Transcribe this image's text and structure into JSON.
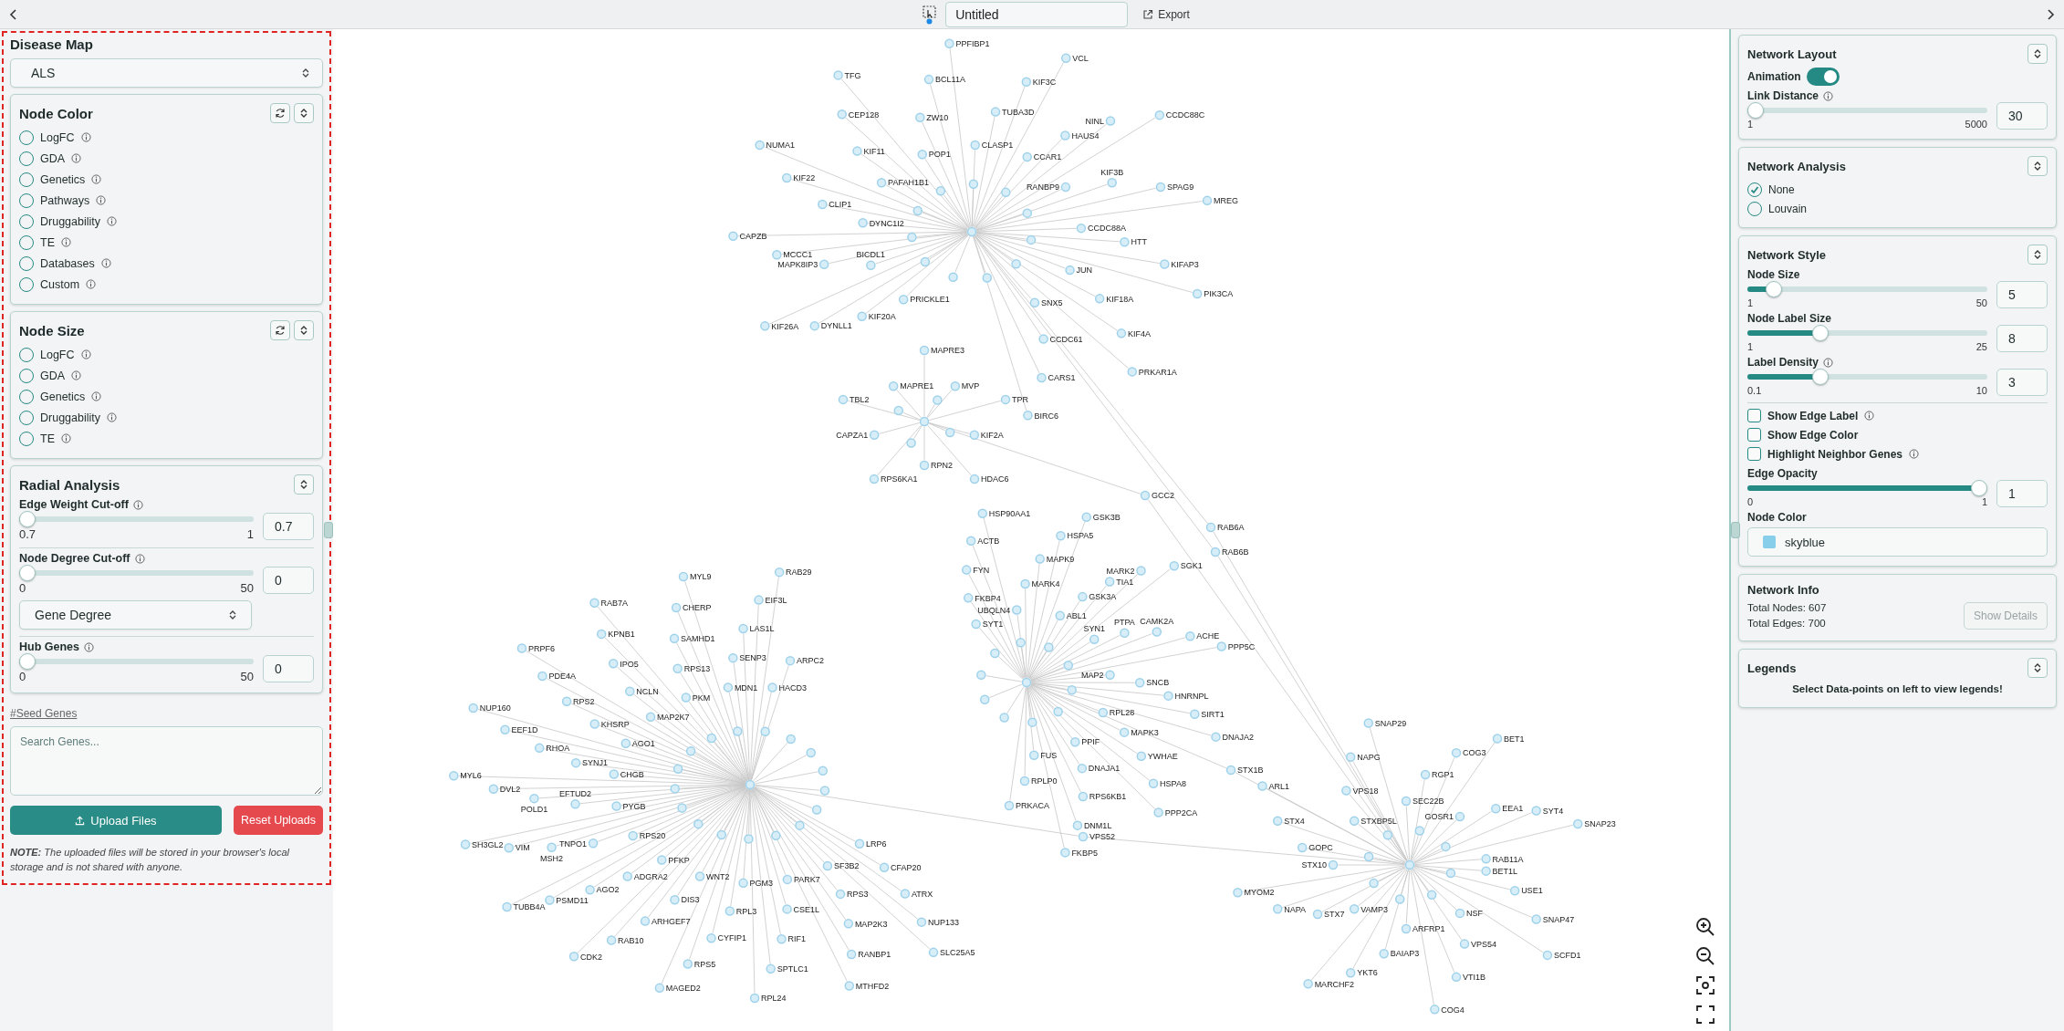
{
  "top_bar": {
    "document_title": "Untitled",
    "export": "Export"
  },
  "left_panel": {
    "disease_map": {
      "title": "Disease Map",
      "value": "ALS"
    },
    "cards": [
      {
        "kind": "radios",
        "title": "Node Color",
        "refresh": true,
        "options": [
          {
            "label": "LogFC",
            "info": true,
            "selected": false
          },
          {
            "label": "GDA",
            "info": true,
            "selected": false
          },
          {
            "label": "Genetics",
            "info": true,
            "selected": false
          },
          {
            "label": "Pathways",
            "info": true,
            "selected": false
          },
          {
            "label": "Druggability",
            "info": true,
            "selected": false
          },
          {
            "label": "TE",
            "info": true,
            "selected": false
          },
          {
            "label": "Databases",
            "info": true,
            "selected": false
          },
          {
            "label": "Custom",
            "info": true,
            "selected": false
          }
        ]
      },
      {
        "kind": "radios",
        "title": "Node Size",
        "refresh": true,
        "options": [
          {
            "label": "LogFC",
            "info": true,
            "selected": false
          },
          {
            "label": "GDA",
            "info": true,
            "selected": false
          },
          {
            "label": "Genetics",
            "info": true,
            "selected": false
          },
          {
            "label": "Druggability",
            "info": true,
            "selected": false
          },
          {
            "label": "TE",
            "info": true,
            "selected": false
          }
        ]
      },
      {
        "kind": "controls",
        "title": "Radial Analysis",
        "items": [
          {
            "kind": "slider",
            "label": "Edge Weight Cut-off",
            "info": true,
            "min": "0.7",
            "max": "1",
            "value": "0.7",
            "level": 0
          },
          {
            "kind": "slider",
            "label": "Node Degree Cut-off",
            "info": true,
            "min": "0",
            "max": "50",
            "value": "0",
            "level": 0,
            "rule_above": true
          },
          {
            "kind": "select",
            "value": "Gene Degree"
          },
          {
            "kind": "slider",
            "label": "Hub Genes",
            "info": true,
            "min": "0",
            "max": "50",
            "value": "0",
            "level": 0,
            "rule_above": true
          }
        ]
      }
    ],
    "seed_link": "#Seed Genes",
    "search_placeholder": "Search Genes...",
    "upload": "Upload Files",
    "reset": "Reset Uploads",
    "note": "**NOTE:** The uploaded files will be stored in your browser's local storage and is not shared with anyone."
  },
  "graph": {
    "hubs": [
      {
        "labels": [
          "PPFIBP1",
          "VCL",
          "TFG",
          "BCL11A",
          "KIF3C",
          "CEP128",
          "ZW10",
          "TUBA3D",
          "NINL",
          "CCDC88C",
          "HAUS4",
          "NUMA1",
          "KIF11",
          "CLASP1",
          "POP1",
          "CCAR1",
          "KIF22",
          "KIF3B",
          "PAFAH1B1",
          "RANBP9",
          "SPAG9",
          "CLIP1",
          "MREG",
          "DYNC1I2",
          "CCDC88A",
          "CAPZB",
          "HTT",
          "MCCC1",
          "BICDL1",
          "MAPK8IP3",
          "JUN",
          "KIFAP3",
          "PRICKLE1",
          "SNX5",
          "KIF18A",
          "PIK3CA",
          "KIF20A",
          "KIF26A",
          "DYNLL1",
          "CCDC61",
          "KIF4A",
          "CARS1",
          "PRKAR1A",
          "BIRC6"
        ]
      },
      {
        "labels": [
          "MAPRE3",
          "MAPRE1",
          "MVP",
          "TBL2",
          "TPR",
          "CAPZA1",
          "KIF2A",
          "RPN2",
          "RPS6KA1",
          "HDAC6"
        ]
      },
      {
        "labels": [
          "HSP90AA1",
          "GSK3B",
          "ACTB",
          "HSPA5",
          "MAPK9",
          "FYN",
          "MARK2",
          "SGK1",
          "MARK4",
          "TIA1",
          "FKBP4",
          "GSK3A",
          "UBQLN4",
          "ABL1",
          "SYT1",
          "PTPA",
          "CAMK2A",
          "SYN1",
          "ACHE",
          "PPP5C",
          "MAP2",
          "SNCB",
          "HNRNPL",
          "RPL28",
          "SIRT1",
          "MAPK3",
          "PPIF",
          "DNAJA2",
          "FUS",
          "YWHAE",
          "DNAJA1",
          "RPLP0",
          "HSPA8",
          "RPS6KB1",
          "PRKACA",
          "PPP2CA",
          "DNM1L",
          "FKBP5"
        ]
      },
      {
        "labels": [
          "MYL9",
          "RAB29",
          "RAB7A",
          "EIF3L",
          "CHERP",
          "KPNB1",
          "LAS1L",
          "SAMHD1",
          "PRPF6",
          "IPO5",
          "SENP3",
          "ARPC2",
          "RPS13",
          "PDE4A",
          "NCLN",
          "MDN1",
          "HACD3",
          "NUP160",
          "RPS2",
          "PKM",
          "EEF1D",
          "KHSRP",
          "MAP2K7",
          "RHOA",
          "AGO1",
          "SYNJ1",
          "MYL6",
          "CHGB",
          "DVL2",
          "EFTUD2",
          "POLD1",
          "PYGB",
          "RPS20",
          "SH3GL2",
          "VIM",
          "TNPO1",
          "LRP6",
          "MSH2",
          "PFKP",
          "SF3B2",
          "CFAP20",
          "ADGRA2",
          "WNT2",
          "PGM3",
          "PARK7",
          "AGO2",
          "PSMD11",
          "DIS3",
          "RPS3",
          "ATRX",
          "TUBB4A",
          "RPL3",
          "CSE1L",
          "ARHGEF7",
          "MAP2K3",
          "NUP133",
          "RAB10",
          "CYFIP1",
          "RIF1",
          "CDK2",
          "RANBP1",
          "SLC25A5",
          "RPS5",
          "SPTLC1",
          "MAGED2",
          "MTHFD2",
          "RPL24"
        ]
      },
      {
        "labels": [
          "SNAP29",
          "BET1",
          "NAPG",
          "COG3",
          "RGP1",
          "ARL1",
          "VPS18",
          "SEC22B",
          "EEA1",
          "GOSR1",
          "SYT4",
          "STX4",
          "STXBP5L",
          "SNAP23",
          "GOPC",
          "STX10",
          "RAB11A",
          "BET1L",
          "MYOM2",
          "USE1",
          "NAPA",
          "STX7",
          "VAMP3",
          "NSF",
          "SNAP47",
          "ARFRP1",
          "VPS54",
          "BAIAP3",
          "SCFD1",
          "YKT6",
          "MARCHF2",
          "VTI1B",
          "COG4"
        ]
      }
    ],
    "bridges": [
      {
        "label": "GCC2"
      },
      {
        "label": "RAB6A"
      },
      {
        "label": "RAB6B"
      },
      {
        "label": "STX1B"
      },
      {
        "label": "VPS52"
      }
    ]
  },
  "right_panel": {
    "cards": [
      {
        "kind": "controls",
        "title": "Network Layout",
        "items": [
          {
            "kind": "toggle",
            "label": "Animation",
            "on": true
          },
          {
            "kind": "slider",
            "label": "Link Distance",
            "info": true,
            "min": "1",
            "max": "5000",
            "value": "30",
            "level": 0
          }
        ]
      },
      {
        "kind": "radios",
        "title": "Network Analysis",
        "options": [
          {
            "label": "None",
            "selected": true
          },
          {
            "label": "Louvain",
            "selected": false
          }
        ]
      },
      {
        "kind": "controls",
        "title": "Network Style",
        "items": [
          {
            "kind": "slider",
            "label": "Node Size",
            "min": "1",
            "max": "50",
            "value": "5",
            "level": 0.08
          },
          {
            "kind": "slider",
            "label": "Node Label Size",
            "min": "1",
            "max": "25",
            "value": "8",
            "level": 0.29
          },
          {
            "kind": "slider",
            "label": "Label Density",
            "info": true,
            "min": "0.1",
            "max": "10",
            "value": "3",
            "level": 0.29
          },
          {
            "kind": "checkbox",
            "label": "Show Edge Label",
            "info": true,
            "checked": false,
            "rule_above": true
          },
          {
            "kind": "checkbox",
            "label": "Show Edge Color",
            "checked": false
          },
          {
            "kind": "checkbox",
            "label": "Highlight Neighbor Genes",
            "info": true,
            "checked": false
          },
          {
            "kind": "slider",
            "label": "Edge Opacity",
            "min": "0",
            "max": "1",
            "value": "1",
            "level": 1
          },
          {
            "kind": "color",
            "label": "Node Color",
            "value": "skyblue",
            "color": "#87ceeb"
          }
        ]
      },
      {
        "kind": "info",
        "title": "Network Info",
        "lines": [
          "Total Nodes: 607",
          "Total Edges: 700"
        ],
        "button": {
          "label": "Show Details",
          "disabled": true
        }
      },
      {
        "kind": "text",
        "title": "Legends",
        "text": "Select Data-points on left to view legends!"
      }
    ]
  }
}
